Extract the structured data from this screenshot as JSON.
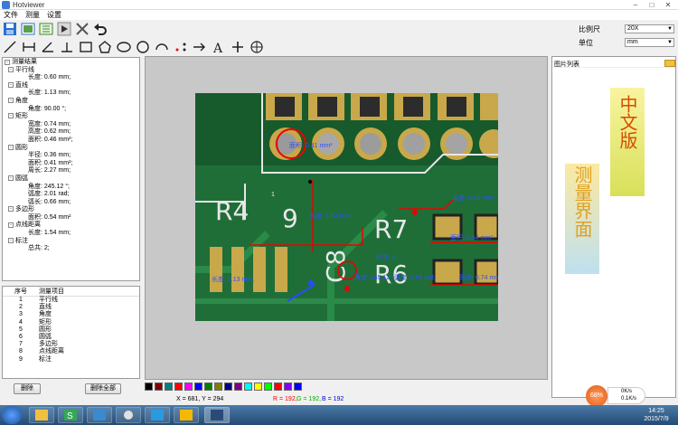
{
  "window": {
    "title": "Hotviewer"
  },
  "menu": [
    "文件",
    "测量",
    "设置"
  ],
  "toolbar_top": [
    "save-icon",
    "image-icon",
    "export-icon",
    "play-icon",
    "crossed-tools-icon",
    "undo-icon"
  ],
  "toolbar_draw": [
    "line-icon",
    "parallel-line-icon",
    "angle-icon",
    "perpendicular-icon",
    "rectangle-icon",
    "pentagon-icon",
    "ellipse-icon",
    "circle-icon",
    "arc-icon",
    "point-distance-icon",
    "arrow-icon",
    "text-icon",
    "crosshair-icon",
    "target-icon"
  ],
  "toolbar_draw_glyphs": [
    "╱",
    "⊢",
    "∠",
    "⊥",
    "□",
    "⬠",
    "⬭",
    "○",
    "⌒",
    "·:",
    "→",
    "A",
    "+",
    "⊕"
  ],
  "toolbar_top_glyphs": [
    "💾",
    "▣",
    "▦",
    "▶",
    "✕",
    "↶"
  ],
  "controls": {
    "scale_label": "比例尺",
    "scale_value": "20X",
    "unit_label": "单位",
    "unit_value": "mm"
  },
  "tree": {
    "root": "测量结果",
    "groups": [
      {
        "name": "平行线",
        "items": [
          "长度: 0.60 mm;"
        ]
      },
      {
        "name": "直线",
        "items": [
          "长度: 1.13 mm;"
        ]
      },
      {
        "name": "角度",
        "items": [
          "角度: 90.00 °;"
        ]
      },
      {
        "name": "矩形",
        "items": [
          "宽度: 0.74 mm;",
          "高度: 0.62 mm;",
          "面积: 0.46 mm²;"
        ]
      },
      {
        "name": "圆形",
        "items": [
          "半径: 0.36 mm;",
          "面积: 0.41 mm²;",
          "周长: 2.27 mm;"
        ]
      },
      {
        "name": "圆弧",
        "items": [
          "角度: 245.12 °;",
          "弧度: 2.01 rad;",
          "弧长: 0.66 mm;"
        ]
      },
      {
        "name": "多边形",
        "items": [
          "面积: 0.54 mm²"
        ]
      },
      {
        "name": "点线距离",
        "items": [
          "长度: 1.54 mm;"
        ]
      },
      {
        "name": "标注",
        "items": [
          "总共: 2;"
        ]
      }
    ]
  },
  "list": {
    "columns": [
      "序号",
      "测量项目"
    ],
    "rows": [
      [
        "1",
        "平行线"
      ],
      [
        "2",
        "直线"
      ],
      [
        "3",
        "角度"
      ],
      [
        "4",
        "矩形"
      ],
      [
        "5",
        "圆形"
      ],
      [
        "6",
        "圆弧"
      ],
      [
        "7",
        "多边形"
      ],
      [
        "8",
        "点线距离"
      ],
      [
        "9",
        "标注"
      ]
    ]
  },
  "buttons": {
    "delete": "删除",
    "delete_all": "删除全部"
  },
  "palette": [
    "#000000",
    "#800000",
    "#008080",
    "#ff0000",
    "#ff00ff",
    "#0000ff",
    "#008000",
    "#808000",
    "#000080",
    "#800080",
    "#00ffff",
    "#ffff00",
    "#00ff00",
    "#ff0000",
    "#8000ff",
    "#0000ff"
  ],
  "status": {
    "xy": "X = 681, Y = 294",
    "r": "R = 192,",
    "g": "G = 192,",
    "b": "B = 192"
  },
  "gallery": {
    "title": "图片列表",
    "badge1": "中文版",
    "badge2": "测量界面"
  },
  "overlays": {
    "circle_area": "面积: 0.41 mm²",
    "line_len": "长度: 1.54 mm;",
    "parallel": "1",
    "rect_w": "长度: 0.60 mm;",
    "poly_area": "面积: 0.54 mm²",
    "arc": "角度: 245.12°;弧度: 2.01 rad;",
    "rect2": "宽度: 0.74 mm;",
    "left_len": "长度: 1.13 mm;",
    "marks": "标注: 2",
    "pcb_r4": "R4",
    "pcb_r7": "R7",
    "pcb_r6": "R6",
    "pcb_c8": "C8",
    "pcb_9": "9"
  },
  "net": {
    "pct": "68%",
    "up": "0K/s",
    "down": "0.1K/s"
  },
  "clock": {
    "time": "14:25",
    "date": "2015/7/9"
  }
}
